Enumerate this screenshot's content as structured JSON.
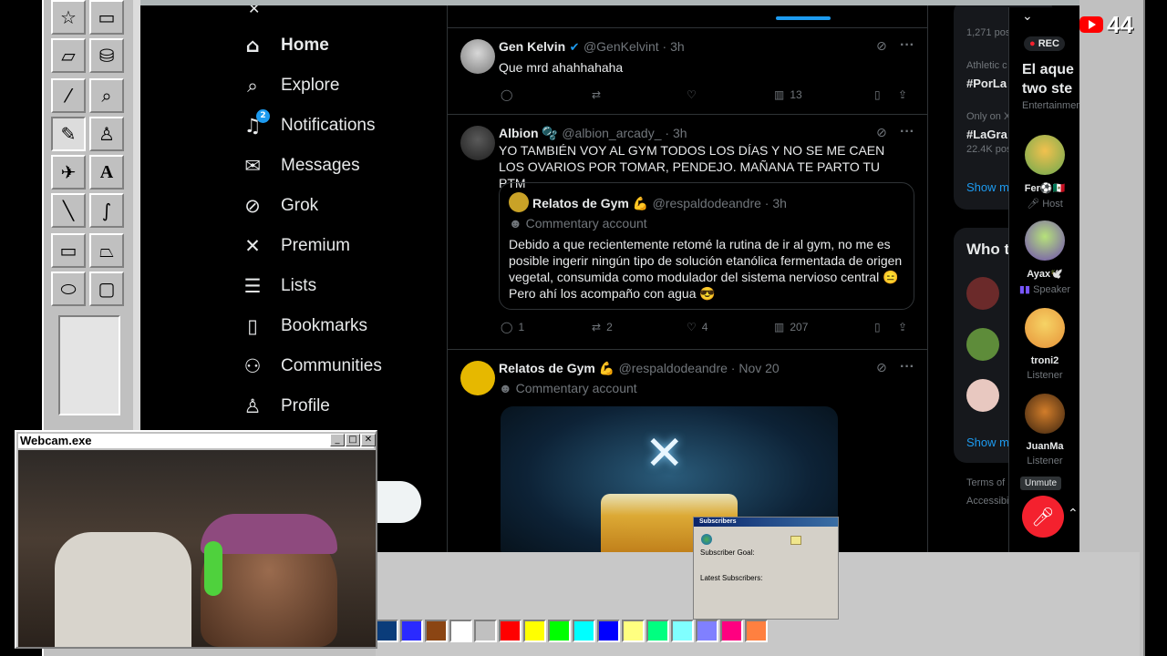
{
  "paint": {
    "palette": [
      "#0a3c7a",
      "#2a2aff",
      "#8b4513",
      "#ffffff",
      "#c0c0c0",
      "#ff0000",
      "#ffff00",
      "#00ff00",
      "#00ffff",
      "#0000ff",
      "#ffff80",
      "#00ff80",
      "#80ffff",
      "#8080ff",
      "#ff0080",
      "#ff8040"
    ]
  },
  "x": {
    "nav": [
      {
        "label": "Home",
        "icon": "home-icon",
        "active": true
      },
      {
        "label": "Explore",
        "icon": "search-icon"
      },
      {
        "label": "Notifications",
        "icon": "bell-icon",
        "badge": "2"
      },
      {
        "label": "Messages",
        "icon": "mail-icon"
      },
      {
        "label": "Grok",
        "icon": "grok-icon"
      },
      {
        "label": "Premium",
        "icon": "x-logo-icon"
      },
      {
        "label": "Lists",
        "icon": "list-icon"
      },
      {
        "label": "Bookmarks",
        "icon": "bookmark-icon"
      },
      {
        "label": "Communities",
        "icon": "communities-icon"
      },
      {
        "label": "Profile",
        "icon": "profile-icon"
      }
    ],
    "posts": [
      {
        "name": "Gen Kelvin",
        "verified": true,
        "handle": "@GenKelvint · 3h",
        "text": "Que mrd ahahhahaha",
        "replies": "",
        "reposts": "",
        "likes": "",
        "views": "13"
      },
      {
        "name": "Albion 🫧",
        "handle": "@albion_arcady_ · 3h",
        "text": "YO TAMBIÉN VOY AL GYM TODOS LOS DÍAS Y NO SE ME CAEN LOS OVARIOS POR TOMAR, PENDEJO. MAÑANA TE PARTO TU PTM",
        "quote": {
          "name": "Relatos de Gym 💪",
          "handle": "@respaldodeandre · 3h",
          "label": "Commentary account",
          "text": "Debido a que recientemente retomé la rutina de ir al gym, no me es posible ingerir ningún tipo de solución etanólica fermentada de origen vegetal, consumida como modulador del sistema nervioso central 😑 Pero ahí los acompaño con agua 😎"
        },
        "replies": "1",
        "reposts": "2",
        "likes": "4",
        "views": "207"
      },
      {
        "name": "Relatos de Gym 💪",
        "handle": "@respaldodeandre · Nov 20",
        "label": "Commentary account"
      }
    ],
    "right": {
      "posts_count": "1,271 pos",
      "trends": [
        {
          "context": "Athletic c",
          "name": "#PorLa"
        },
        {
          "context": "Only on X",
          "name": "#LaGra",
          "count": "22.4K pos"
        }
      ],
      "show_more": "Show m",
      "who_to_follow": "Who t",
      "footer": [
        "Terms of S",
        "Accessibil"
      ]
    }
  },
  "space": {
    "rec": "REC",
    "title": "El aque two ste",
    "category": "Entertainmen",
    "users": [
      {
        "name": "Fer⚽🇲🇽",
        "role": "Host",
        "color": "#6aa84f"
      },
      {
        "name": "Ayax🕊️",
        "role": "Speaker",
        "color": "#8fb3d9"
      },
      {
        "name": "troni2",
        "role": "Listener",
        "color": "#e69138"
      },
      {
        "name": "JuanMa",
        "role": "Listener",
        "color": "#5b3a1e"
      }
    ],
    "unmute": "Unmute"
  },
  "youtube": {
    "viewers": "44"
  },
  "webcam": {
    "title": "Webcam.exe"
  },
  "subscribers": {
    "title": "Subscribers",
    "goal": "Subscriber Goal:",
    "latest": "Latest Subscribers:"
  }
}
